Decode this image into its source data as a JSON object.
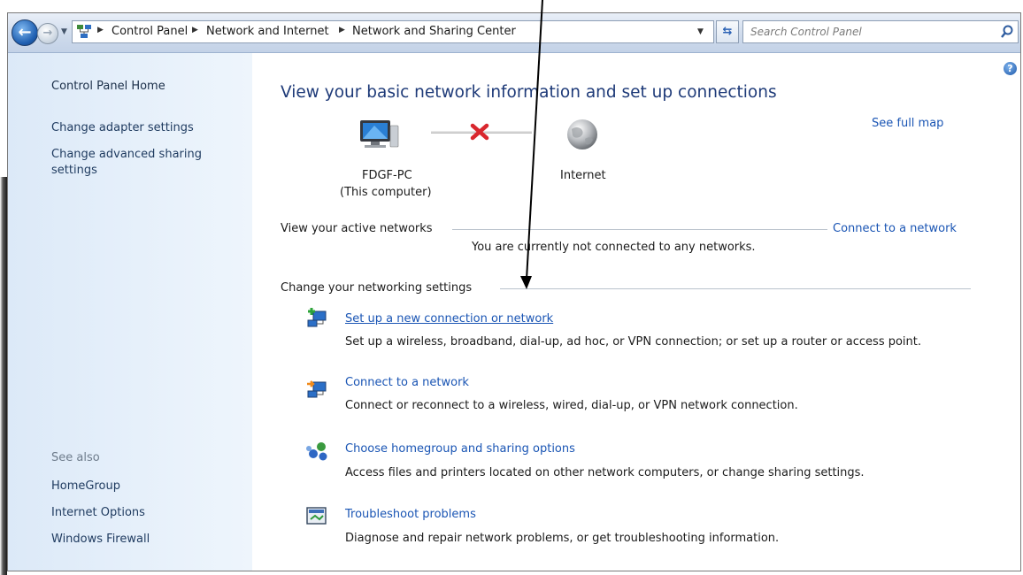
{
  "address_bar": {
    "breadcrumbs": [
      "Control Panel",
      "Network and Internet",
      "Network and Sharing Center"
    ],
    "search_placeholder": "Search Control Panel"
  },
  "nav": {
    "home": "Control Panel Home",
    "links": [
      "Change adapter settings",
      "Change advanced sharing",
      "settings"
    ],
    "see_also_label": "See also",
    "see_also": [
      "HomeGroup",
      "Internet Options",
      "Windows Firewall"
    ]
  },
  "content": {
    "title": "View your basic network information and set up connections",
    "see_full_map": "See full map",
    "computer_name": "FDGF-PC",
    "computer_sub": "(This computer)",
    "internet_label": "Internet",
    "active_networks_label": "View your active networks",
    "connect_link": "Connect to a network",
    "not_connected": "You are currently not connected to any networks.",
    "change_settings_label": "Change your networking settings",
    "tasks": [
      {
        "title": "Set up a new connection or network",
        "desc": "Set up a wireless, broadband, dial-up, ad hoc, or VPN connection; or set up a router or access point.",
        "icon": "new-connection-icon"
      },
      {
        "title": "Connect to a network",
        "desc": "Connect or reconnect to a wireless, wired, dial-up, or VPN network connection.",
        "icon": "connect-network-icon"
      },
      {
        "title": "Choose homegroup and sharing options",
        "desc": "Access files and printers located on other network computers, or change sharing settings.",
        "icon": "homegroup-icon"
      },
      {
        "title": "Troubleshoot problems",
        "desc": "Diagnose and repair network problems, or get troubleshooting information.",
        "icon": "troubleshoot-icon"
      }
    ]
  },
  "colors": {
    "link": "#1a55b4",
    "title": "#1e3a78",
    "nav_bg": "#dce9f8",
    "error_x": "#d9272e"
  }
}
